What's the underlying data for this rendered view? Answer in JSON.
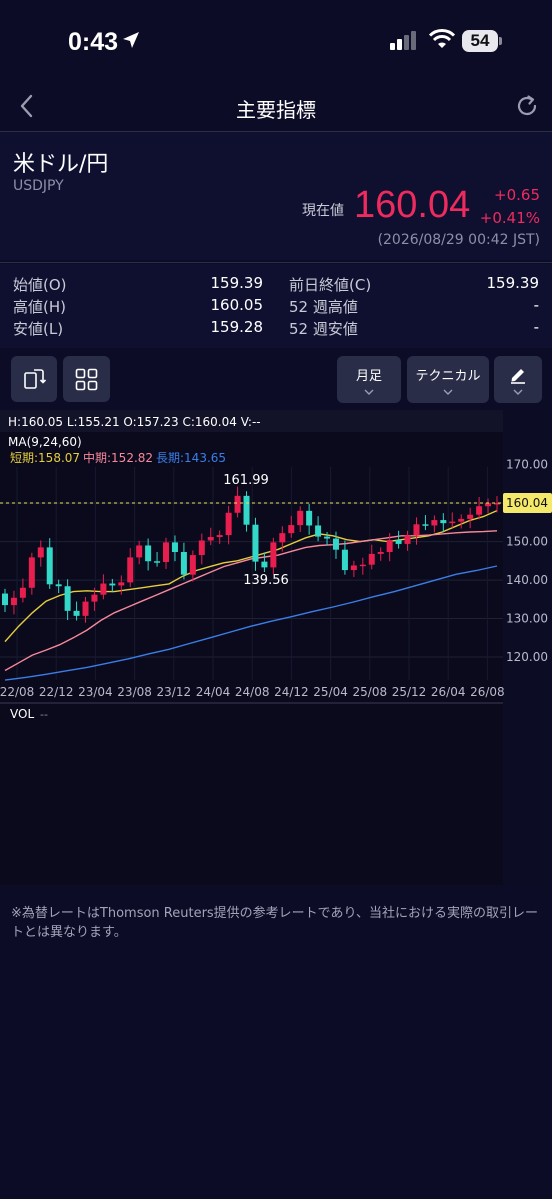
{
  "status_bar": {
    "time": "0:43",
    "battery": "54"
  },
  "nav": {
    "title": "主要指標"
  },
  "quote": {
    "name": "米ドル/円",
    "code": "USDJPY",
    "current_label": "現在値",
    "price": "160.04",
    "change_abs": "+0.65",
    "change_pct": "+0.41%",
    "timestamp": "(2026/08/29 00:42 JST)"
  },
  "stats": {
    "left": [
      {
        "label": "始値(O)",
        "value": "159.39"
      },
      {
        "label": "高値(H)",
        "value": "160.05"
      },
      {
        "label": "安値(L)",
        "value": "159.28"
      }
    ],
    "right": [
      {
        "label": "前日終値(C)",
        "value": "159.39"
      },
      {
        "label": "52 週高値",
        "value": "-"
      },
      {
        "label": "52 週安値",
        "value": "-"
      }
    ]
  },
  "toolbar": {
    "period_label": "月足",
    "technical_label": "テクニカル"
  },
  "chart_info": {
    "ohlcv": "H:160.05   L:155.21   O:157.23   C:160.04   V:--",
    "ma_title": "MA(9,24,60)",
    "ma_short": "短期:158.07",
    "ma_mid": "中期:152.82",
    "ma_long": "長期:143.65",
    "vol_label": "VOL",
    "vol_value": "--",
    "high_annotation": "161.99",
    "low_annotation": "139.56",
    "last_price_tag": "160.04"
  },
  "chart_data": {
    "type": "candlestick",
    "y_ticks": [
      170,
      160,
      150,
      140,
      130,
      120
    ],
    "x_ticks": [
      "22/08",
      "22/12",
      "23/04",
      "23/08",
      "23/12",
      "24/04",
      "24/08",
      "24/12",
      "25/04",
      "25/08",
      "25/12",
      "26/04",
      "26/08"
    ],
    "ylim": [
      113.5,
      172
    ],
    "candles_close": [
      133.5,
      135.4,
      138.0,
      145.9,
      148.5,
      138.9,
      138.4,
      132.0,
      130.7,
      134.4,
      136.2,
      139.1,
      138.6,
      139.4,
      145.9,
      149.0,
      144.9,
      144.7,
      149.8,
      147.3,
      141.4,
      146.5,
      150.3,
      151.2,
      151.7,
      157.5,
      161.9,
      154.4,
      144.8,
      143.3,
      149.8,
      152.2,
      154.3,
      158.0,
      154.2,
      151.3,
      150.8,
      147.9,
      142.6,
      143.8,
      144.0,
      146.8,
      147.3,
      150.4,
      149.4,
      151.6,
      154.5,
      154.2,
      155.6,
      154.8,
      155.2,
      155.9,
      157.0,
      159.2,
      160.0,
      160.04
    ],
    "candle_start_open": 136.5,
    "series": [
      {
        "name": "短期",
        "color": "#e5cd3c",
        "values": [
          124.0,
          128.0,
          131.5,
          134.5,
          136.0,
          137.0,
          137.2,
          137.0,
          137.0,
          137.5,
          138.0,
          138.5,
          139.0,
          141.0,
          142.5,
          143.5,
          144.5,
          145.0,
          146.0,
          147.0,
          148.0,
          149.5,
          151.0,
          152.0,
          151.5,
          150.5,
          150.0,
          150.5,
          150.0,
          150.5,
          151.0,
          151.5,
          152.5,
          154.0,
          155.5,
          156.5,
          158.07
        ]
      },
      {
        "name": "中期",
        "color": "#f6889a",
        "values": [
          116.5,
          118.5,
          120.5,
          121.8,
          123.2,
          125.0,
          127.0,
          129.5,
          131.5,
          133.0,
          134.5,
          136.0,
          137.5,
          139.0,
          140.5,
          142.0,
          143.5,
          144.5,
          145.5,
          146.0,
          146.5,
          147.5,
          148.5,
          149.0,
          149.2,
          149.5,
          150.0,
          150.5,
          151.0,
          151.5,
          151.5,
          151.7,
          152.0,
          152.3,
          152.5,
          152.6,
          152.82
        ]
      },
      {
        "name": "長期",
        "color": "#3a7ee8",
        "values": [
          114.0,
          114.7,
          115.5,
          116.4,
          117.3,
          118.4,
          119.5,
          120.8,
          122.0,
          123.5,
          125.0,
          126.5,
          128.0,
          129.3,
          130.5,
          131.8,
          133.0,
          134.3,
          135.7,
          137.0,
          138.5,
          140.0,
          141.5,
          142.5,
          143.65
        ]
      }
    ]
  },
  "disclaimer": "※為替レートはThomson Reuters提供の参考レートであり、当社における実際の取引レートとは異なります。"
}
